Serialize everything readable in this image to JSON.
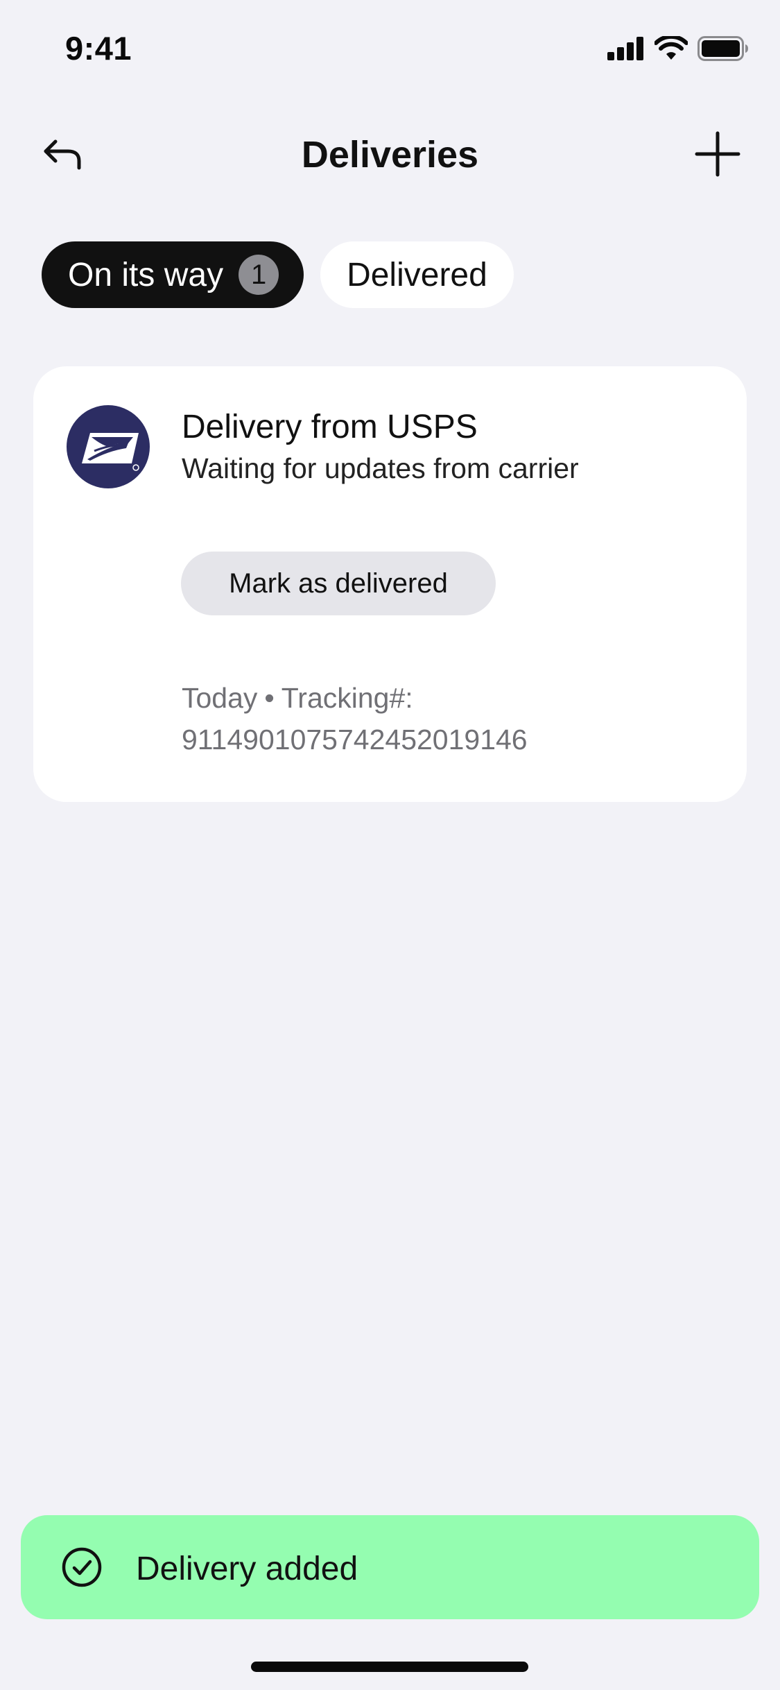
{
  "status_bar": {
    "time": "9:41",
    "icons": [
      "cellular-signal-icon",
      "wifi-icon",
      "battery-icon"
    ]
  },
  "header": {
    "title": "Deliveries",
    "back_icon": "reply-arrow-icon",
    "add_icon": "plus-icon"
  },
  "tabs": [
    {
      "label": "On its way",
      "count": "1",
      "active": true
    },
    {
      "label": "Delivered",
      "active": false
    }
  ],
  "delivery": {
    "carrier_logo": "usps-eagle-logo",
    "title": "Delivery from USPS",
    "status": "Waiting for updates from carrier",
    "action_label": "Mark as delivered",
    "date": "Today",
    "separator": "•",
    "tracking_label": "Tracking#:",
    "tracking_number": "9114901075742452019146"
  },
  "toast": {
    "icon": "check-circle-icon",
    "message": "Delivery added"
  },
  "colors": {
    "background": "#f2f2f7",
    "card": "#ffffff",
    "active_tab": "#111111",
    "toast": "#94fdb0",
    "usps_blue": "#2c2d63",
    "secondary_button": "#e5e5ea"
  }
}
